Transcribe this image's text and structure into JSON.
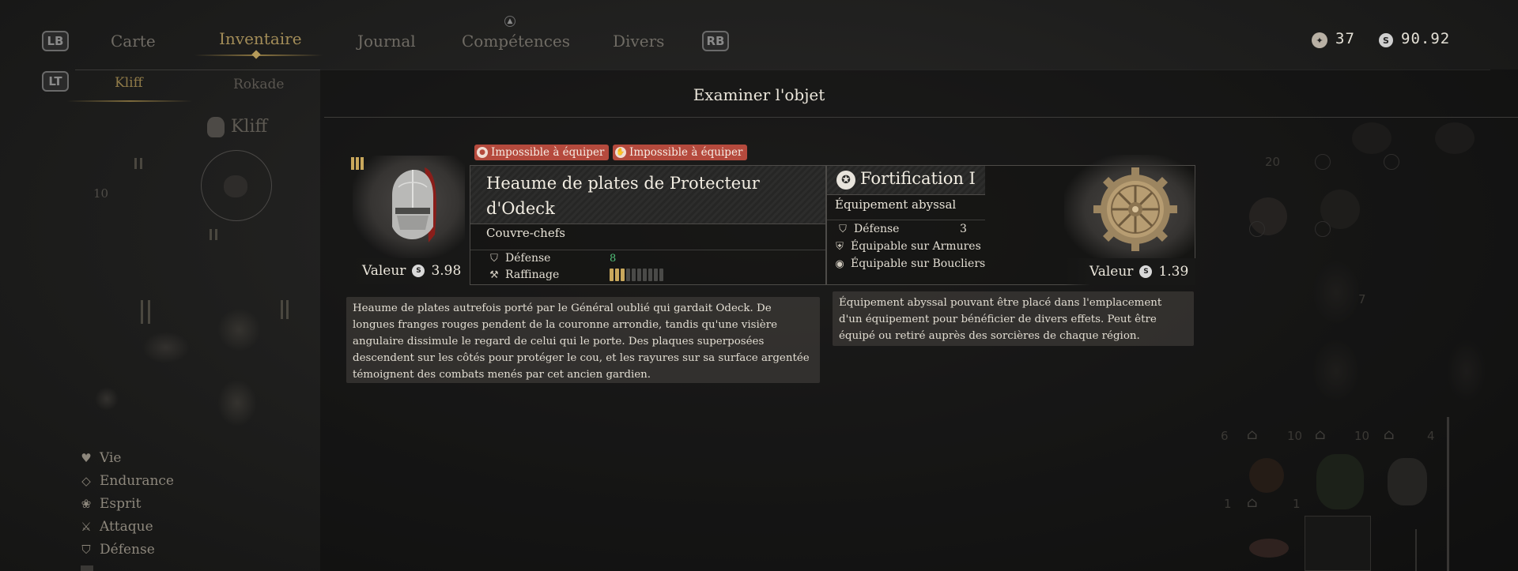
{
  "nav": {
    "lb": "LB",
    "rb": "RB",
    "tabs": [
      "Carte",
      "Inventaire",
      "Journal",
      "Compétences",
      "Divers"
    ],
    "lt": "LT",
    "subtabs": [
      "Kliff",
      "Rokade"
    ]
  },
  "currency": {
    "abyss_icon": "abyss-coin-icon",
    "abyss_value": "37",
    "silver_icon": "silver-coin-icon",
    "silver_value": "90.92"
  },
  "character": {
    "name": "Kliff",
    "stats": [
      "Vie",
      "Endurance",
      "Esprit",
      "Attaque",
      "Défense"
    ],
    "level_label": "10"
  },
  "modal": {
    "title": "Examiner l'objet",
    "item": {
      "badges": [
        "Impossible à équiper",
        "Impossible à équiper"
      ],
      "name": "Heaume de plates de Protecteur d'Odeck",
      "category": "Couvre-chefs",
      "stats": [
        {
          "label": "Défense",
          "value": "8"
        },
        {
          "label": "Raffinage",
          "value": ""
        }
      ],
      "refinement": {
        "level": 3,
        "max": 10
      },
      "value_label": "Valeur",
      "value": "3.98",
      "description": "Heaume de plates autrefois porté par le Général oublié qui gardait Odeck. De longues franges rouges pendent de la couronne arrondie, tandis qu'une visière angulaire dissimule le regard de celui qui le porte. Des plaques superposées descendent sur les côtés pour protéger le cou, et les rayures sur sa surface argentée témoignent des combats menés par cet ancien gardien."
    },
    "abyss_item": {
      "name": "Fortification I",
      "category": "Équipement abyssal",
      "stats": [
        {
          "label": "Défense",
          "value": "3"
        },
        {
          "label": "Équipable sur Armures",
          "value": ""
        },
        {
          "label": "Équipable sur Boucliers",
          "value": ""
        }
      ],
      "value_label": "Valeur",
      "value": "1.39",
      "description": "Équipement abyssal pouvant être placé dans l'emplacement d'un équipement pour bénéficier de divers effets. Peut être équipé ou retiré auprès des sorcières de chaque région."
    }
  },
  "inventory": {
    "numbers": [
      "20",
      "7",
      "6",
      "10",
      "10",
      "4",
      "1",
      "1"
    ]
  },
  "colors": {
    "accent_gold": "#a38d58",
    "badge_red": "#b54a3d",
    "stat_green": "#52c27a",
    "refine_gold": "#c9a85c"
  }
}
